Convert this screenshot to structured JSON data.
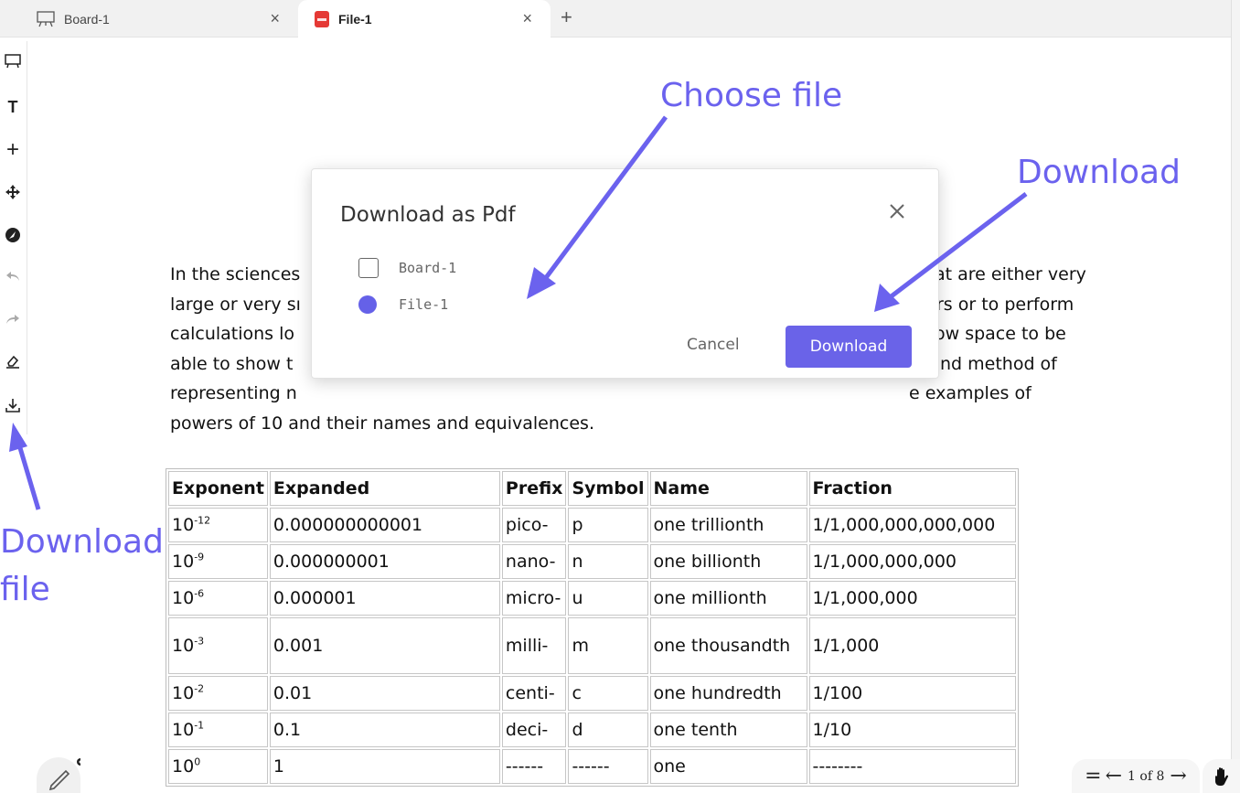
{
  "tabs": [
    {
      "label": "Board-1",
      "icon": "whiteboard-icon",
      "active": false
    },
    {
      "label": "File-1",
      "icon": "pdf-file-icon",
      "active": true
    }
  ],
  "tab_close_glyph": "×",
  "new_tab_glyph": "+",
  "toolbar": {
    "tools": [
      "whiteboard-tool",
      "text-tool",
      "add-tool",
      "move-tool",
      "navigate-tool",
      "undo-tool",
      "redo-tool",
      "eraser-tool",
      "download-tool"
    ],
    "text_tool_glyph": "T",
    "add_tool_glyph": "+"
  },
  "document": {
    "lines_left": [
      "In the sciences",
      "large or very sı",
      "calculations lo",
      "able to show t",
      "representing n",
      "powers of 10 and their names and equivalences."
    ],
    "lines_right": [
      "at are either very",
      "rs or to perform",
      "ow space to be",
      "nd method of",
      "e examples of"
    ],
    "table": {
      "headers": [
        "Exponent",
        "Expanded",
        "Prefix",
        "Symbol",
        "Name",
        "Fraction"
      ],
      "rows": [
        {
          "base": "10",
          "exp": "-12",
          "expanded": "0.000000000001",
          "prefix": "pico-",
          "symbol": "p",
          "name": "one trillionth",
          "fraction": "1/1,000,000,000,000"
        },
        {
          "base": "10",
          "exp": "-9",
          "expanded": "0.000000001",
          "prefix": "nano-",
          "symbol": "n",
          "name": "one billionth",
          "fraction": "1/1,000,000,000"
        },
        {
          "base": "10",
          "exp": "-6",
          "expanded": "0.000001",
          "prefix": "micro-",
          "symbol": "u",
          "name": "one millionth",
          "fraction": "1/1,000,000"
        },
        {
          "base": "10",
          "exp": "-3",
          "expanded": "0.001",
          "prefix": "milli-",
          "symbol": "m",
          "name": "one thousandth",
          "fraction": "1/1,000"
        },
        {
          "base": "10",
          "exp": "-2",
          "expanded": "0.01",
          "prefix": "centi-",
          "symbol": "c",
          "name": "one hundredth",
          "fraction": "1/100"
        },
        {
          "base": "10",
          "exp": "-1",
          "expanded": "0.1",
          "prefix": "deci-",
          "symbol": "d",
          "name": "one tenth",
          "fraction": "1/10"
        },
        {
          "base": "10",
          "exp": "0",
          "expanded": "1",
          "prefix": "------",
          "symbol": "------",
          "name": "one",
          "fraction": "--------"
        }
      ]
    }
  },
  "modal": {
    "title": "Download as Pdf",
    "options": [
      {
        "label": "Board-1",
        "selected": false
      },
      {
        "label": "File-1",
        "selected": true
      }
    ],
    "cancel_label": "Cancel",
    "download_label": "Download"
  },
  "annotations": {
    "choose_file": "Choose file",
    "download": "Download",
    "download_file_line1": "Download",
    "download_file_line2": "file"
  },
  "pager": {
    "text": "1 of 8",
    "menu_glyph": "=",
    "prev_glyph": "←",
    "next_glyph": "→"
  },
  "colors": {
    "accent": "#6a63e8",
    "annotation": "#6b62ee",
    "pdf_badge": "#e53935"
  }
}
